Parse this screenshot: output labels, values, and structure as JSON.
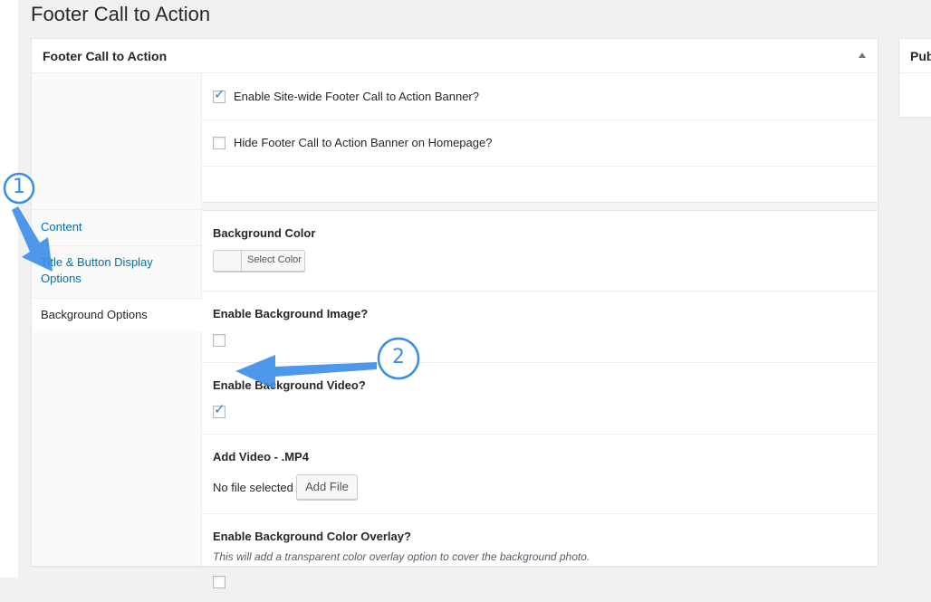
{
  "page": {
    "title": "Footer Call to Action"
  },
  "metabox": {
    "title": "Footer Call to Action"
  },
  "sidebox": {
    "title": "Pub"
  },
  "tabs": [
    {
      "label": "Content",
      "active": false
    },
    {
      "label": "Title & Button Display Options",
      "active": false
    },
    {
      "label": "Background Options",
      "active": true
    }
  ],
  "top_fields": {
    "enable_sitewide": {
      "label": "Enable Site-wide Footer Call to Action Banner?",
      "checked": true
    },
    "hide_homepage": {
      "label": "Hide Footer Call to Action Banner on Homepage?",
      "checked": false
    }
  },
  "background": {
    "color": {
      "label": "Background Color",
      "button": "Select Color"
    },
    "image": {
      "label": "Enable Background Image?",
      "checked": false
    },
    "video": {
      "label": "Enable Background Video?",
      "checked": true
    },
    "add_video": {
      "label": "Add Video - .MP4",
      "status": "No file selected",
      "button": "Add File"
    },
    "overlay": {
      "label": "Enable Background Color Overlay?",
      "description": "This will add a transparent color overlay option to cover the background photo.",
      "checked": false
    }
  },
  "annotations": {
    "badge1": "1",
    "badge2": "2"
  },
  "colors": {
    "accent": "#3a8de8",
    "link": "#0073aa",
    "check": "#1e8cbe"
  }
}
